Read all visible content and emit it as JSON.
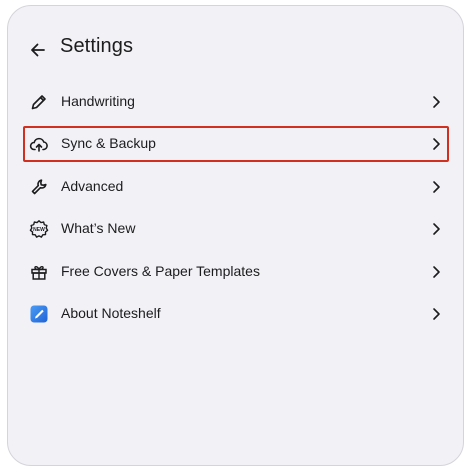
{
  "header": {
    "title": "Settings"
  },
  "menu": {
    "items": [
      {
        "label": "Handwriting",
        "icon": "pencil-icon",
        "selected": false
      },
      {
        "label": "Sync & Backup",
        "icon": "cloud-upload-icon",
        "selected": true
      },
      {
        "label": "Advanced",
        "icon": "wrench-icon",
        "selected": false
      },
      {
        "label": "What’s New",
        "icon": "new-badge-icon",
        "selected": false
      },
      {
        "label": "Free Covers & Paper Templates",
        "icon": "gift-icon",
        "selected": false
      },
      {
        "label": "About Noteshelf",
        "icon": "noteshelf-app-icon",
        "selected": false
      }
    ]
  },
  "colors": {
    "panel_bg": "#f2f1f6",
    "highlight": "#d2301f",
    "app_icon": "#2f7ee8"
  }
}
